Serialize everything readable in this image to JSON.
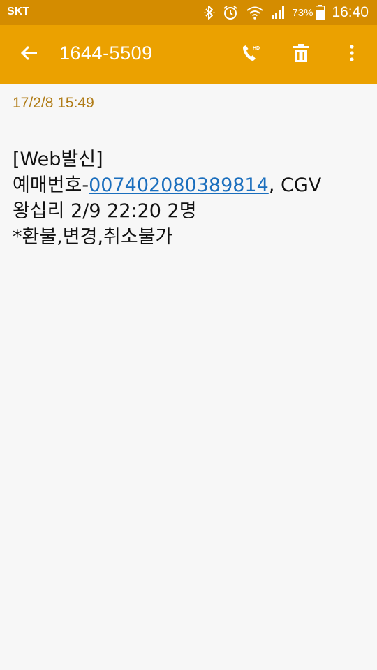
{
  "status_bar": {
    "carrier": "SKT",
    "battery_percent": "73%",
    "time": "16:40",
    "icons": [
      "bluetooth-icon",
      "alarm-icon",
      "wifi-icon",
      "signal-icon",
      "battery-icon"
    ]
  },
  "app_bar": {
    "title": "1644-5509",
    "icons": [
      "back-arrow-icon",
      "hd-call-icon",
      "trash-icon",
      "more-vertical-icon"
    ]
  },
  "message": {
    "timestamp": "17/2/8  15:49",
    "line1": "[Web발신]",
    "line2_prefix": "예매번호-",
    "line2_link": "007402080389814",
    "line2_suffix": ", CGV",
    "line3": "왕십리 2/9 22:20 2명",
    "line4": "*환불,변경,취소불가"
  },
  "colors": {
    "status_bar_bg": "#d48c00",
    "app_bar_bg": "#eba100",
    "timestamp": "#b07c17",
    "link": "#1a6ebd",
    "background": "#f7f7f7"
  }
}
